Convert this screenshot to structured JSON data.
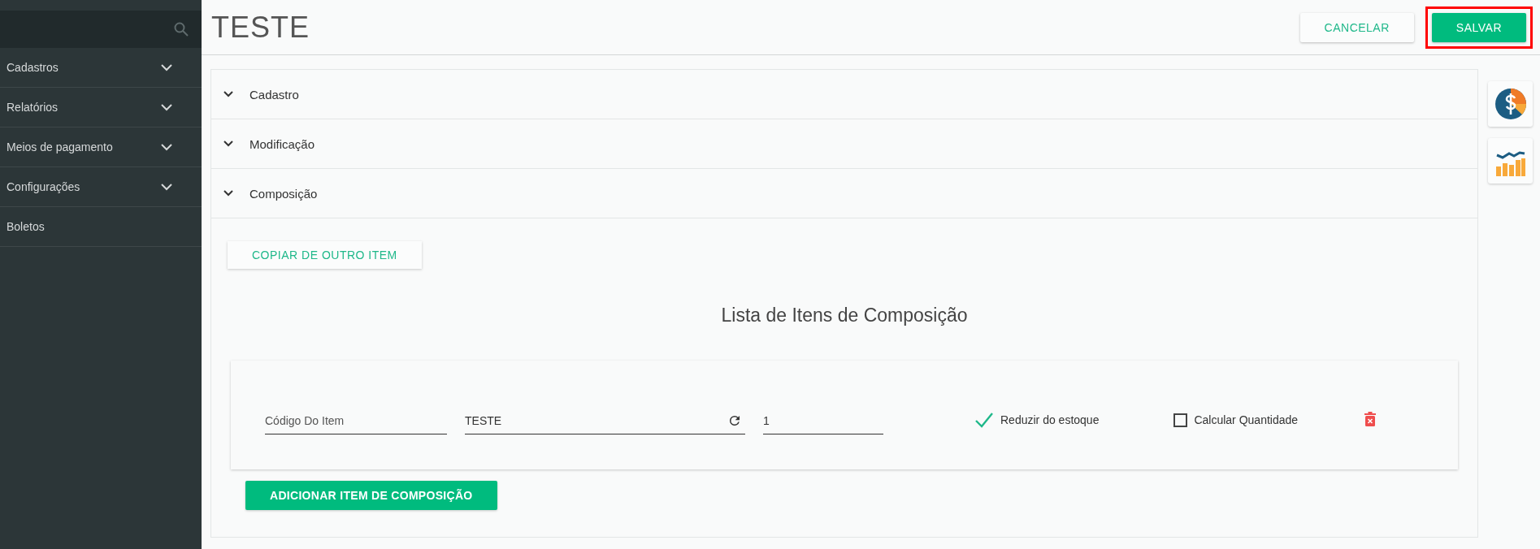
{
  "sidebar": {
    "items": [
      {
        "label": "Cadastros",
        "kind": "group"
      },
      {
        "label": "Relatórios",
        "kind": "group"
      },
      {
        "label": "Meios de pagamento",
        "kind": "group"
      },
      {
        "label": "Configurações",
        "kind": "group"
      },
      {
        "label": "Boletos",
        "kind": "link"
      }
    ]
  },
  "header": {
    "title": "TESTE",
    "buttons": [
      {
        "label": "CANCELAR",
        "kind": "flat"
      },
      {
        "label": "SALVAR",
        "kind": "primary",
        "highlighted": true
      }
    ]
  },
  "sections": [
    {
      "label": "Cadastro"
    },
    {
      "label": "Modificação"
    },
    {
      "label": "Composição"
    }
  ],
  "composition": {
    "copy_button": "COPIAR DE OUTRO ITEM",
    "list_title": "Lista de Itens de Composição",
    "items": [
      {
        "code": {
          "placeholder": "Código Do Item"
        },
        "name": "TESTE",
        "quantity": "1",
        "reduce_stock": {
          "label": "Reduzir do estoque",
          "checked": true
        },
        "calculate_quantity": {
          "label": "Calcular Quantidade",
          "checked": false
        }
      }
    ],
    "add_button": "ADICIONAR ITEM DE COMPOSIÇÃO"
  }
}
